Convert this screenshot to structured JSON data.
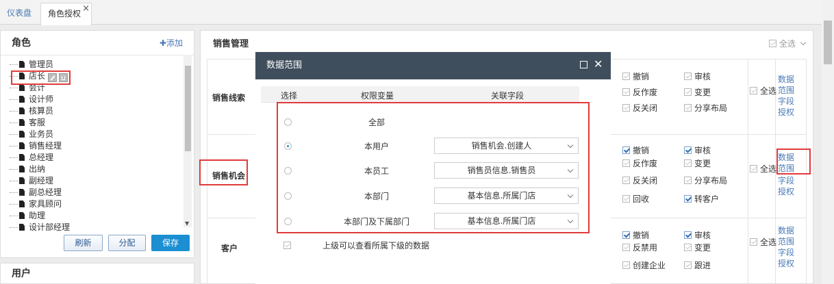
{
  "tabs": [
    {
      "label": "仪表盘",
      "active": false
    },
    {
      "label": "角色授权",
      "active": true
    }
  ],
  "tab_close": "×",
  "role_panel": {
    "title": "角色",
    "add_label": "✚添加",
    "roles": [
      "管理员",
      "店长",
      "会计",
      "设计师",
      "核算员",
      "客服",
      "业务员",
      "销售经理",
      "总经理",
      "出纳",
      "副经理",
      "副总经理",
      "家具顾问",
      "助理",
      "设计部经理"
    ],
    "buttons": {
      "refresh": "刷新",
      "assign": "分配",
      "save": "保存"
    }
  },
  "user_panel": {
    "title": "用户"
  },
  "main": {
    "title": "销售管理",
    "select_all": "全选",
    "modules": [
      {
        "name": "销售线索",
        "perms": [
          {
            "label": "撤销",
            "checked": false
          },
          {
            "label": "审核",
            "checked": false
          },
          {
            "label": "反作废",
            "checked": false
          },
          {
            "label": "变更",
            "checked": false
          },
          {
            "label": "反关闭",
            "checked": false
          },
          {
            "label": "分享布局",
            "checked": false
          }
        ],
        "select_all": "全选",
        "links": [
          "数据范围",
          "字段授权"
        ]
      },
      {
        "name": "销售机会",
        "perms": [
          {
            "label": "撤销",
            "checked": true
          },
          {
            "label": "审核",
            "checked": true
          },
          {
            "label": "反作废",
            "checked": false
          },
          {
            "label": "变更",
            "checked": false
          },
          {
            "label": "反关闭",
            "checked": false
          },
          {
            "label": "分享布局",
            "checked": false
          },
          {
            "label": "回收",
            "checked": false
          },
          {
            "label": "转客户",
            "checked": true
          }
        ],
        "select_all": "全选",
        "links": [
          "数据范围",
          "字段授权"
        ]
      },
      {
        "name": "客户",
        "perms": [
          {
            "label": "撤销",
            "checked": true
          },
          {
            "label": "审核",
            "checked": true
          },
          {
            "label": "反禁用",
            "checked": false
          },
          {
            "label": "变更",
            "checked": false
          },
          {
            "label": "创建企业",
            "checked": false
          },
          {
            "label": "跟进",
            "checked": false
          }
        ],
        "select_all": "全选",
        "links": [
          "数据范围",
          "字段授权"
        ]
      }
    ]
  },
  "modal": {
    "title": "数据范围",
    "columns": [
      "选择",
      "权限变量",
      "关联字段"
    ],
    "rows": [
      {
        "label": "全部",
        "selected": false,
        "field": ""
      },
      {
        "label": "本用户",
        "selected": true,
        "field": "销售机会.创建人"
      },
      {
        "label": "本员工",
        "selected": false,
        "field": "销售员信息.销售员"
      },
      {
        "label": "本部门",
        "selected": false,
        "field": "基本信息.所属门店"
      },
      {
        "label": "本部门及下属部门",
        "selected": false,
        "field": "基本信息.所属门店"
      }
    ],
    "footer_checkbox": "上级可以查看所属下级的数据"
  },
  "colors": {
    "modal_header": "#3f4e5d",
    "primary": "#1b8fd2",
    "highlight": "#e13a3a",
    "link": "#4a7ab5"
  },
  "icons": [
    "maximize-icon",
    "close-icon",
    "edit-icon",
    "delete-icon",
    "document-icon",
    "chevron-down-icon"
  ]
}
